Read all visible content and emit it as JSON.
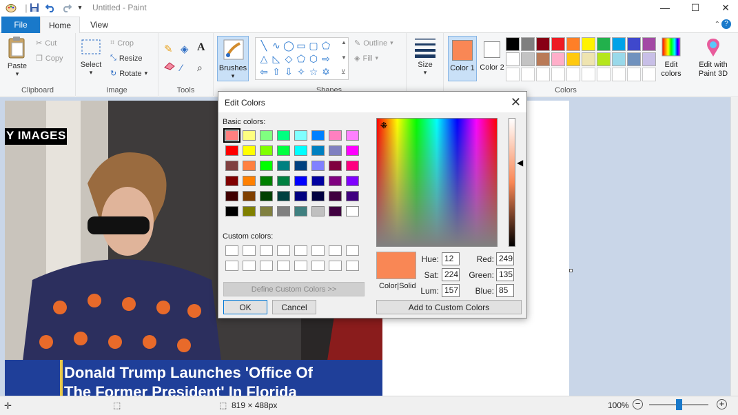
{
  "window": {
    "title": "Untitled - Paint"
  },
  "tabs": {
    "file": "File",
    "home": "Home",
    "view": "View"
  },
  "clipboard": {
    "paste": "Paste",
    "cut": "Cut",
    "copy": "Copy",
    "group": "Clipboard"
  },
  "image": {
    "select": "Select",
    "crop": "Crop",
    "resize": "Resize",
    "rotate": "Rotate",
    "group": "Image"
  },
  "tools": {
    "group": "Tools"
  },
  "brushes": {
    "label": "Brushes"
  },
  "shapes": {
    "outline": "Outline",
    "fill": "Fill",
    "group": "Shapes"
  },
  "size": {
    "label": "Size"
  },
  "colors": {
    "color1": "Color 1",
    "color2": "Color 2",
    "edit_colors": "Edit colors",
    "edit_with_3d": "Edit with Paint 3D",
    "group": "Colors",
    "color1_value": "#f98755",
    "color2_value": "#ffffff",
    "palette_row1": [
      "#000000",
      "#7f7f7f",
      "#880015",
      "#ed1c24",
      "#ff7f27",
      "#fff200",
      "#22b14c",
      "#00a2e8",
      "#3f48cc",
      "#a349a4"
    ],
    "palette_row2": [
      "#ffffff",
      "#c3c3c3",
      "#b97a57",
      "#ffaec9",
      "#ffc90e",
      "#efe4b0",
      "#b5e61d",
      "#99d9ea",
      "#7092be",
      "#c8bfe7"
    ]
  },
  "photo": {
    "watermark": "Y IMAGES",
    "headline_line1": "Donald Trump Launches 'Office Of",
    "headline_line2": "The Former President' In Florida"
  },
  "statusbar": {
    "dimensions": "819 × 488px",
    "zoom": "100%"
  },
  "dialog": {
    "title": "Edit Colors",
    "basic_colors_label": "Basic colors:",
    "custom_colors_label": "Custom colors:",
    "define_custom": "Define Custom Colors >>",
    "ok": "OK",
    "cancel": "Cancel",
    "color_solid": "Color|Solid",
    "add_custom": "Add to Custom Colors",
    "hue_label": "Hue:",
    "hue": "12",
    "sat_label": "Sat:",
    "sat": "224",
    "lum_label": "Lum:",
    "lum": "157",
    "red_label": "Red:",
    "red": "249",
    "green_label": "Green:",
    "green": "135",
    "blue_label": "Blue:",
    "blue": "85",
    "preview_color": "#f98755",
    "basic_colors": [
      [
        "#ff8080",
        "#ffff80",
        "#80ff80",
        "#00ff80",
        "#80ffff",
        "#0080ff",
        "#ff80c0",
        "#ff80ff"
      ],
      [
        "#ff0000",
        "#ffff00",
        "#80ff00",
        "#00ff40",
        "#00ffff",
        "#0080c0",
        "#8080c0",
        "#ff00ff"
      ],
      [
        "#804040",
        "#ff8040",
        "#00ff00",
        "#008080",
        "#004080",
        "#8080ff",
        "#800040",
        "#ff0080"
      ],
      [
        "#800000",
        "#ff8000",
        "#008000",
        "#008040",
        "#0000ff",
        "#0000a0",
        "#800080",
        "#8000ff"
      ],
      [
        "#400000",
        "#804000",
        "#004000",
        "#004040",
        "#000080",
        "#000040",
        "#400040",
        "#400080"
      ],
      [
        "#000000",
        "#808000",
        "#808040",
        "#808080",
        "#408080",
        "#c0c0c0",
        "#400040",
        "#ffffff"
      ]
    ]
  }
}
